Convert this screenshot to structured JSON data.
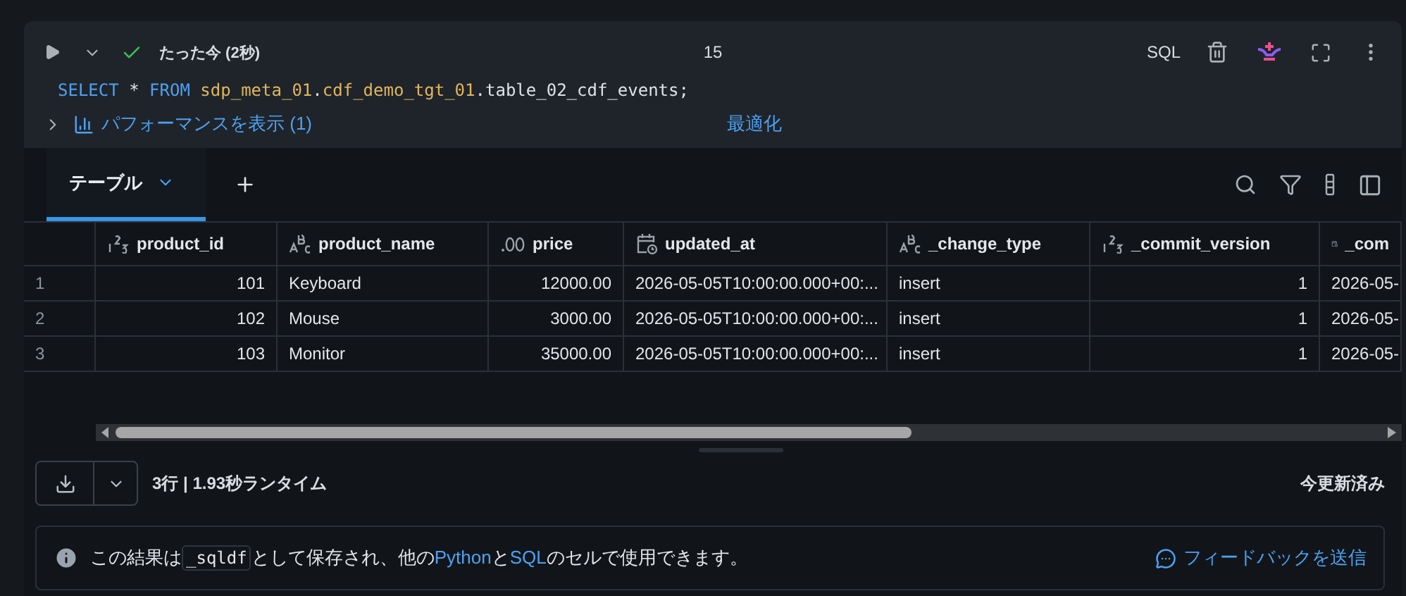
{
  "cell_header": {
    "succeeded": true,
    "run_time": "たった今 (2秒)",
    "cell_number": "15",
    "language": "SQL"
  },
  "sql": [
    {
      "kind": "keyword",
      "text": "SELECT"
    },
    {
      "kind": "plain",
      "text": " * "
    },
    {
      "kind": "keyword",
      "text": "FROM "
    },
    {
      "kind": "name",
      "text": "sdp_meta_01"
    },
    {
      "kind": "plain",
      "text": "."
    },
    {
      "kind": "name",
      "text": "cdf_demo_tgt_01"
    },
    {
      "kind": "plain",
      "text": ".table_02_cdf_events;"
    }
  ],
  "performance": {
    "expanded": false,
    "label": "パフォーマンスを表示 (1)",
    "optimize": "最適化"
  },
  "result_tabs": [
    {
      "label": "テーブル",
      "selected": true
    }
  ],
  "table": {
    "columns": [
      {
        "kind": "integer",
        "label": "product_id"
      },
      {
        "kind": "string",
        "label": "product_name"
      },
      {
        "kind": "decimal",
        "label": "price"
      },
      {
        "kind": "timestamp",
        "label": "updated_at"
      },
      {
        "kind": "string",
        "label": "_change_type"
      },
      {
        "kind": "integer",
        "label": "_commit_version"
      },
      {
        "kind": "timestamp",
        "label": "_com"
      }
    ],
    "rows": [
      {
        "index": "1",
        "cells": [
          "101",
          "Keyboard",
          "12000.00",
          "2026-05-05T10:00:00.000+00:...",
          "insert",
          "1",
          "2026-05-"
        ]
      },
      {
        "index": "2",
        "cells": [
          "102",
          "Mouse",
          "3000.00",
          "2026-05-05T10:00:00.000+00:...",
          "insert",
          "1",
          "2026-05-"
        ]
      },
      {
        "index": "3",
        "cells": [
          "103",
          "Monitor",
          "35000.00",
          "2026-05-05T10:00:00.000+00:...",
          "insert",
          "1",
          "2026-05-"
        ]
      }
    ]
  },
  "footer": {
    "summary": "3行 | 1.93秒ランタイム",
    "refreshed": "今更新済み"
  },
  "info": {
    "parts": [
      {
        "kind": "text",
        "text": "この結果は"
      },
      {
        "kind": "code",
        "text": "_sqldf"
      },
      {
        "kind": "text",
        "text": "として保存され、他の"
      },
      {
        "kind": "link",
        "text": "Python"
      },
      {
        "kind": "text",
        "text": "と"
      },
      {
        "kind": "link",
        "text": "SQL"
      },
      {
        "kind": "text",
        "text": "のセルで使用できます。"
      }
    ],
    "feedback": "フィードバックを送信"
  }
}
